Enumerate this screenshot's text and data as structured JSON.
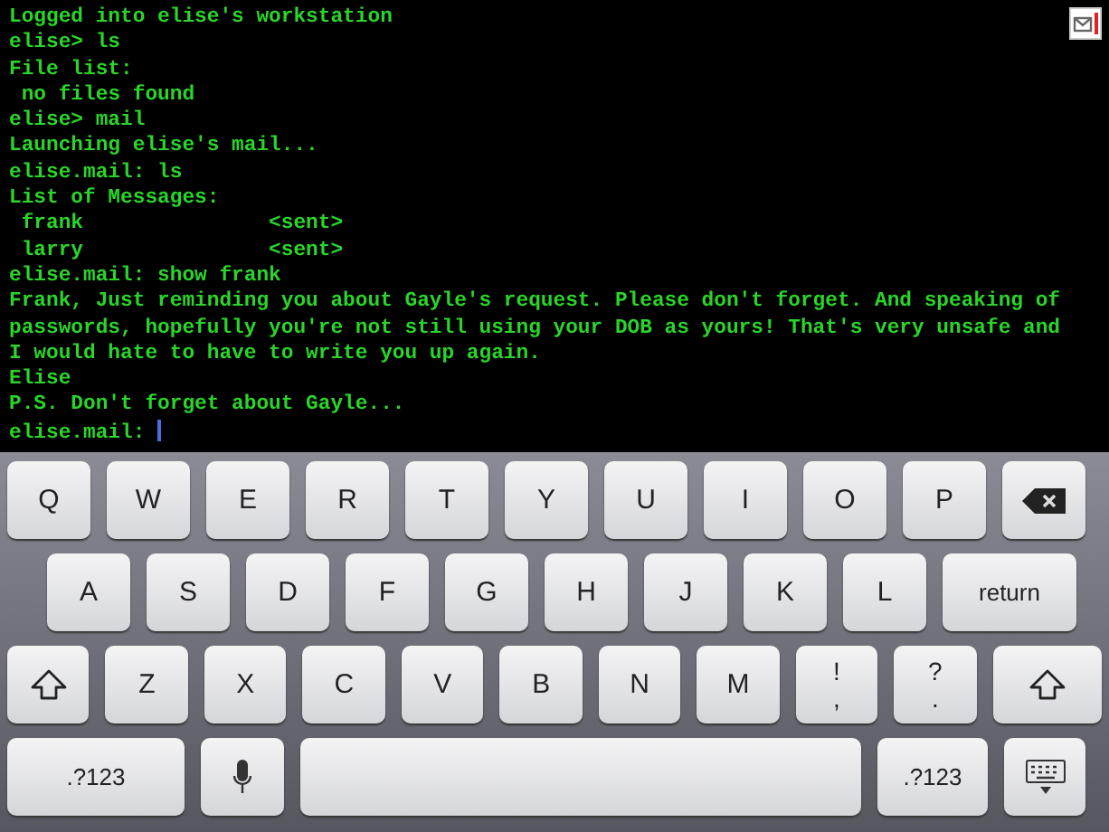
{
  "terminal": {
    "lines": [
      "Logged into elise's workstation",
      "elise> ls",
      "File list:",
      " no files found",
      "elise> mail",
      "Launching elise's mail...",
      "elise.mail: ls",
      "List of Messages:",
      " frank               <sent>",
      " larry               <sent>",
      "elise.mail: show frank",
      "Frank, Just reminding you about Gayle's request. Please don't forget. And speaking of passwords, hopefully you're not still using your DOB as yours! That's very unsafe and I would hate to have to write you up again.",
      "Elise",
      "P.S. Don't forget about Gayle...",
      "elise.mail: "
    ],
    "cursor": true
  },
  "keyboard": {
    "rows": [
      {
        "keys": [
          {
            "kind": "letter",
            "label": "Q"
          },
          {
            "kind": "letter",
            "label": "W"
          },
          {
            "kind": "letter",
            "label": "E"
          },
          {
            "kind": "letter",
            "label": "R"
          },
          {
            "kind": "letter",
            "label": "T"
          },
          {
            "kind": "letter",
            "label": "Y"
          },
          {
            "kind": "letter",
            "label": "U"
          },
          {
            "kind": "letter",
            "label": "I"
          },
          {
            "kind": "letter",
            "label": "O"
          },
          {
            "kind": "letter",
            "label": "P"
          },
          {
            "kind": "backspace"
          }
        ]
      },
      {
        "keys": [
          {
            "kind": "letter",
            "label": "A"
          },
          {
            "kind": "letter",
            "label": "S"
          },
          {
            "kind": "letter",
            "label": "D"
          },
          {
            "kind": "letter",
            "label": "F"
          },
          {
            "kind": "letter",
            "label": "G"
          },
          {
            "kind": "letter",
            "label": "H"
          },
          {
            "kind": "letter",
            "label": "J"
          },
          {
            "kind": "letter",
            "label": "K"
          },
          {
            "kind": "letter",
            "label": "L"
          },
          {
            "kind": "return",
            "label": "return"
          }
        ]
      },
      {
        "keys": [
          {
            "kind": "shift"
          },
          {
            "kind": "letter",
            "label": "Z"
          },
          {
            "kind": "letter",
            "label": "X"
          },
          {
            "kind": "letter",
            "label": "C"
          },
          {
            "kind": "letter",
            "label": "V"
          },
          {
            "kind": "letter",
            "label": "B"
          },
          {
            "kind": "letter",
            "label": "N"
          },
          {
            "kind": "letter",
            "label": "M"
          },
          {
            "kind": "symbol",
            "label": "!",
            "sub": ","
          },
          {
            "kind": "symbol",
            "label": "?",
            "sub": "."
          },
          {
            "kind": "shift"
          }
        ]
      },
      {
        "keys": [
          {
            "kind": "mode",
            "label": ".?123"
          },
          {
            "kind": "mic"
          },
          {
            "kind": "space"
          },
          {
            "kind": "mode",
            "label": ".?123"
          },
          {
            "kind": "hide"
          }
        ]
      }
    ]
  }
}
